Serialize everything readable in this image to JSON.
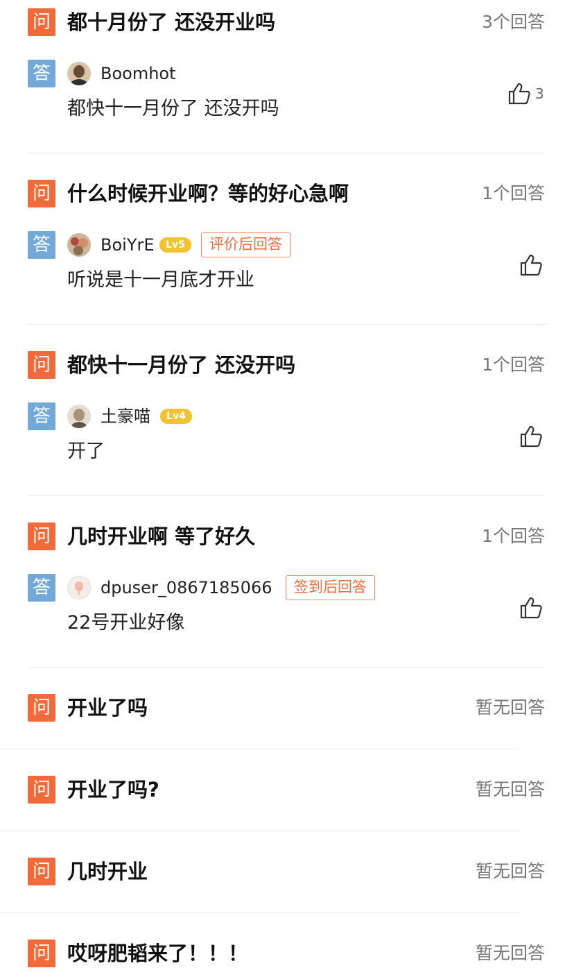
{
  "question_badge": "问",
  "answer_badge": "答",
  "items": [
    {
      "question": "都十月份了 还没开业吗",
      "answer_count": "3个回答",
      "answer": {
        "username": "Boomhot",
        "text": "都快十一月份了 还没开吗",
        "likes": "3"
      }
    },
    {
      "question": "什么时候开业啊？等的好心急啊",
      "answer_count": "1个回答",
      "answer": {
        "username": "BoiYrE",
        "level": "Lv5",
        "tag": "评价后回答",
        "text": "听说是十一月底才开业"
      }
    },
    {
      "question": "都快十一月份了 还没开吗",
      "answer_count": "1个回答",
      "answer": {
        "username": "土豪喵",
        "level": "Lv4",
        "text": "开了"
      }
    },
    {
      "question": "几时开业啊 等了好久",
      "answer_count": "1个回答",
      "answer": {
        "username": "dpuser_0867185066",
        "tag": "签到后回答",
        "text": "22号开业好像"
      }
    },
    {
      "question": "开业了吗",
      "answer_count": "暂无回答"
    },
    {
      "question": "开业了吗?",
      "answer_count": "暂无回答"
    },
    {
      "question": "几时开业",
      "answer_count": "暂无回答"
    },
    {
      "question": "哎呀肥韬来了！！！",
      "answer_count": "暂无回答"
    }
  ],
  "colors": {
    "question_badge": "#f16b3a",
    "answer_badge": "#72a9d8",
    "level_badge": "#f2c230",
    "tag_border": "#f08a62"
  },
  "icons": {
    "like": "thumbs-up-icon",
    "avatar": "avatar"
  }
}
